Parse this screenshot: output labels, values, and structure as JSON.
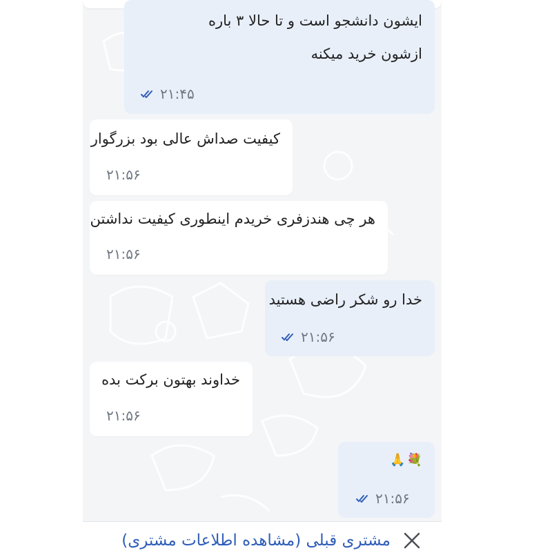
{
  "messages": [
    {
      "lines": [
        "ایشون دانشجو است و تا حالا ۳ باره",
        "ازشون خرید میکنه"
      ],
      "time": "۲۱:۴۵",
      "direction": "outgoing",
      "read": true
    },
    {
      "lines": [
        "کیفیت صداش عالی بود بزرگوار"
      ],
      "time": "۲۱:۵۶",
      "direction": "incoming"
    },
    {
      "lines": [
        "هر چی هندزفری خریدم اینطوری کیفیت نداشتن"
      ],
      "time": "۲۱:۵۶",
      "direction": "incoming"
    },
    {
      "lines": [
        "خدا رو شکر راضی هستید"
      ],
      "time": "۲۱:۵۶",
      "direction": "outgoing",
      "read": true
    },
    {
      "lines": [
        "خداوند بهتون برکت بده"
      ],
      "time": "۲۱:۵۶",
      "direction": "incoming"
    },
    {
      "emojis": [
        "💐",
        "🙏"
      ],
      "time": "۲۱:۵۶",
      "direction": "outgoing",
      "read": true
    }
  ],
  "footer": {
    "label": "مشتری قبلی (مشاهده اطلاعات مشتری)",
    "close_icon": "close-icon"
  },
  "colors": {
    "outgoing_bubble": "#e8eff9",
    "incoming_bubble": "#ffffff",
    "chat_background": "#f4f5f7",
    "read_ticks": "#2f5db8",
    "footer_link": "#2f5db8"
  }
}
